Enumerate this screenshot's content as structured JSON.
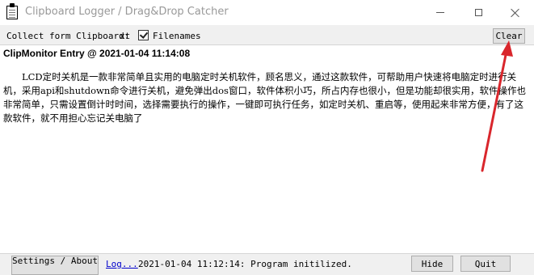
{
  "window": {
    "title": "Clipboard Logger / Drag&Drop Catcher"
  },
  "toolbar": {
    "collect_label": "Collect form Clipboard:",
    "collect_suffix": "xt",
    "filenames_label": "Filenames",
    "filenames_checked": true,
    "clear_label": "Clear"
  },
  "entry": {
    "header": "ClipMonitor Entry @ 2021-01-04 11:14:08",
    "body": "LCD定时关机是一款非常简单且实用的电脑定时关机软件，顾名思义，通过这款软件，可帮助用户快速将电脑定时进行关机，采用api和shutdown命令进行关机，避免弹出dos窗口，软件体积小巧，所占内存也很小，但是功能却很实用，软件操作也非常简单，只需设置倒计时时间，选择需要执行的操作，一键即可执行任务，如定时关机、重启等，使用起来非常方便，有了这款软件，就不用担心忘记关电脑了"
  },
  "statusbar": {
    "settings_label": "Settings / About",
    "log_link": "Log...",
    "status_text": "2021-01-04 11:12:14: Program initilized.",
    "hide_label": "Hide",
    "quit_label": "Quit"
  },
  "colors": {
    "annotation_arrow": "#d9262c",
    "link": "#0000cc"
  },
  "icons": {
    "app": "clipboard-icon",
    "minimize": "minimize-icon",
    "maximize": "maximize-icon",
    "close": "close-icon"
  }
}
